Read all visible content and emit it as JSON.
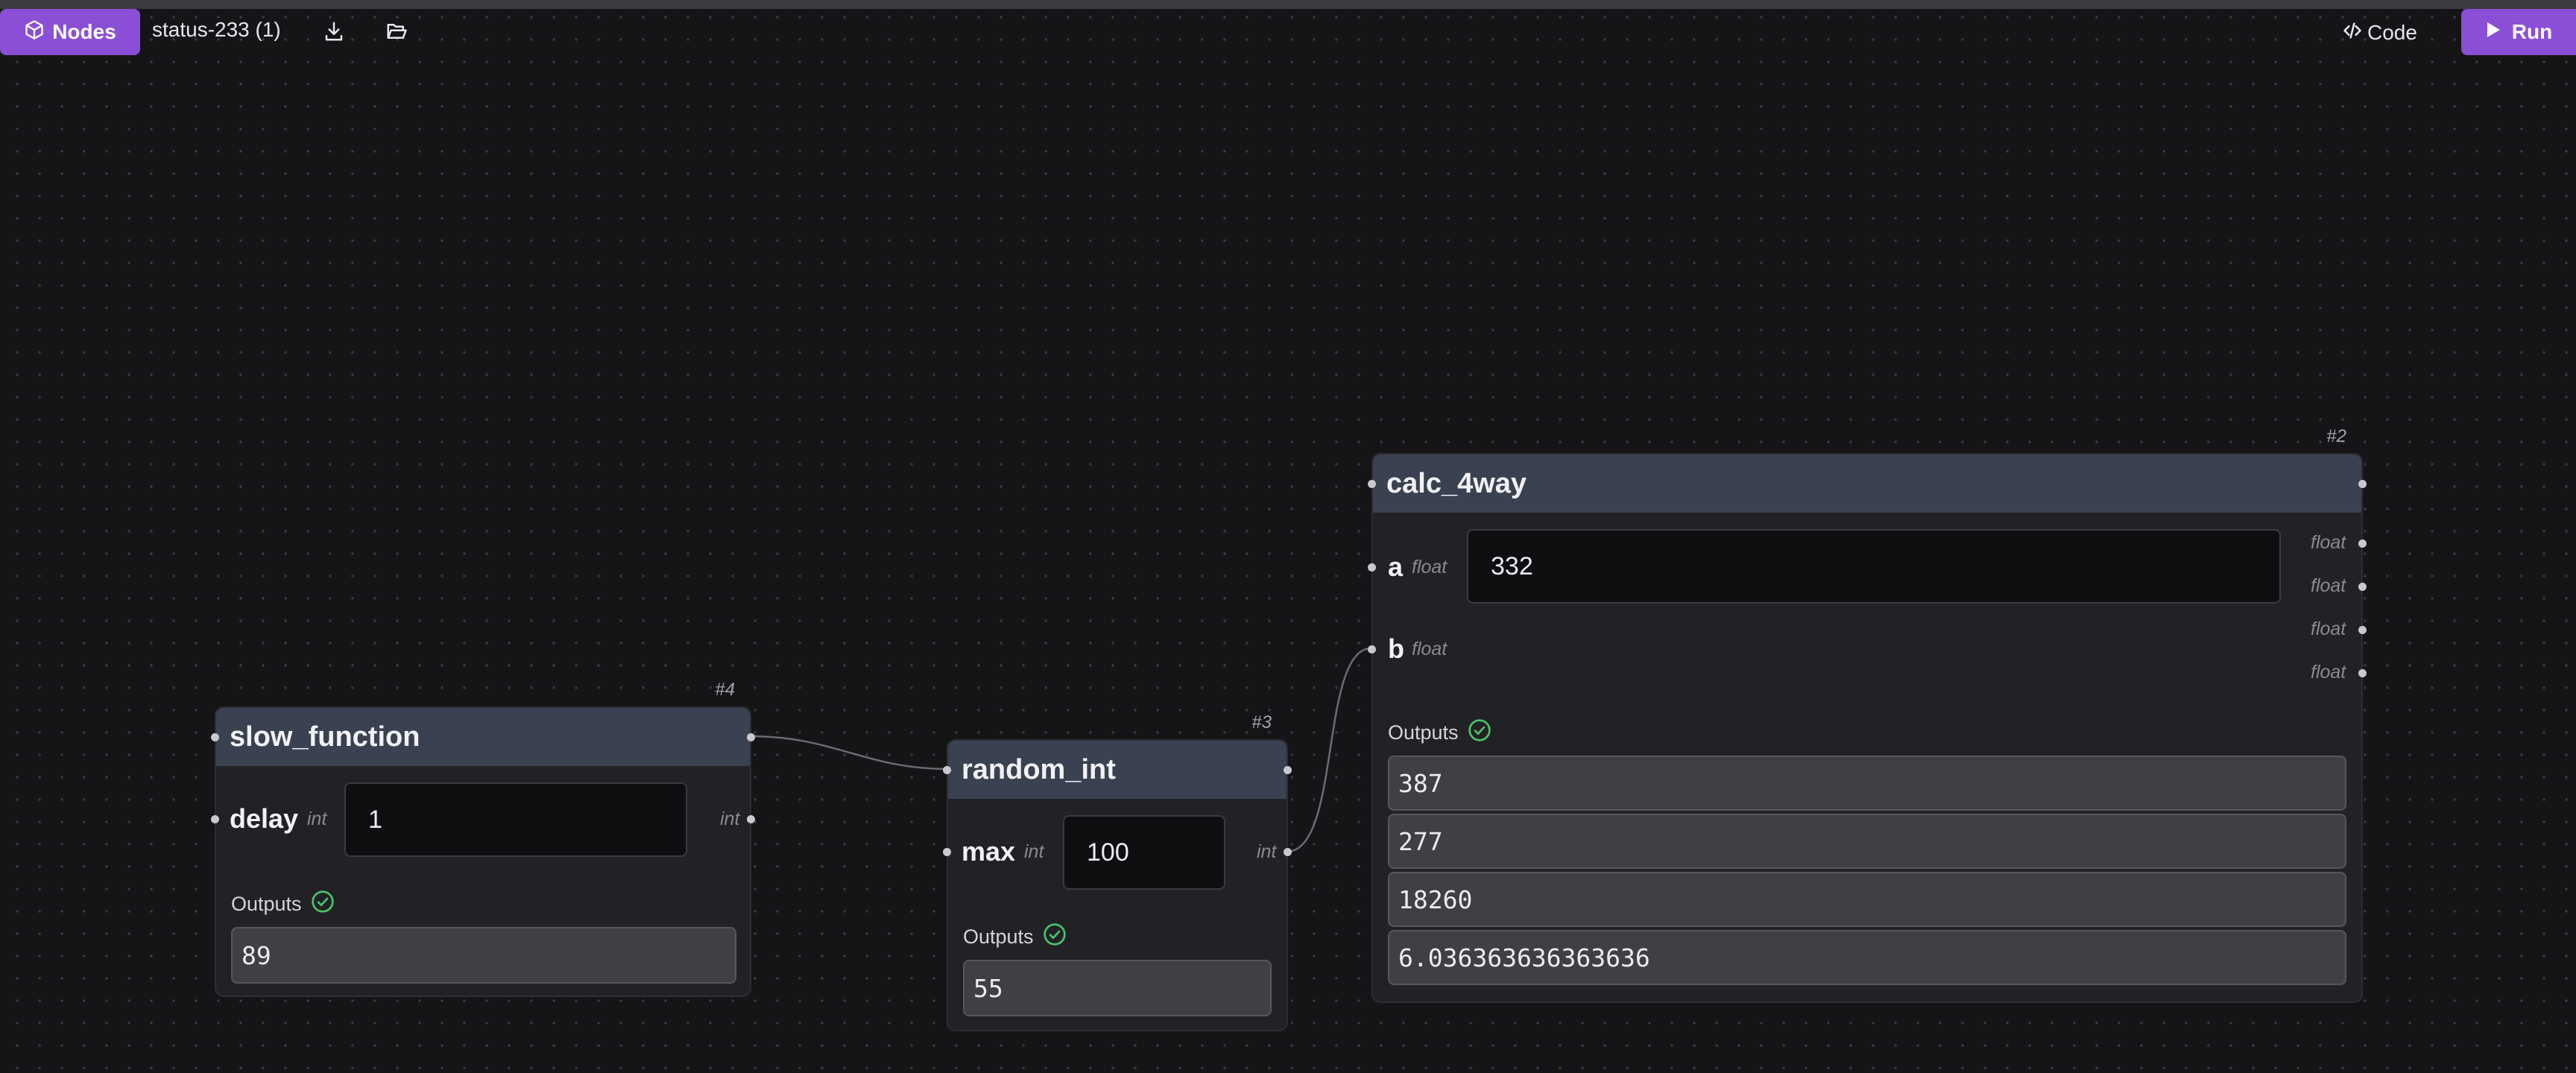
{
  "toolbar": {
    "nodes_label": "Nodes",
    "filename": "status-233 (1)",
    "code_label": "Code",
    "run_label": "Run",
    "accent_color": "#8a4fd6"
  },
  "nodes": {
    "slow_function": {
      "id": "#4",
      "title": "slow_function",
      "param_name": "delay",
      "param_type": "int",
      "param_value": "1",
      "output_type": "int",
      "outputs_label": "Outputs",
      "outputs": [
        "89"
      ]
    },
    "random_int": {
      "id": "#3",
      "title": "random_int",
      "param_name": "max",
      "param_type": "int",
      "param_value": "100",
      "output_type": "int",
      "outputs_label": "Outputs",
      "outputs": [
        "55"
      ]
    },
    "calc_4way": {
      "id": "#2",
      "title": "calc_4way",
      "param_a_name": "a",
      "param_a_type": "float",
      "param_a_value": "332",
      "param_b_name": "b",
      "param_b_type": "float",
      "output_types": [
        "float",
        "float",
        "float",
        "float"
      ],
      "outputs_label": "Outputs",
      "outputs": [
        "387",
        "277",
        "18260",
        "6.036363636363636"
      ]
    }
  },
  "icons": [
    "cube-icon",
    "download-icon",
    "folder-open-icon",
    "code-icon",
    "play-icon",
    "check-circle-icon"
  ],
  "status_color": "#4cc46a"
}
